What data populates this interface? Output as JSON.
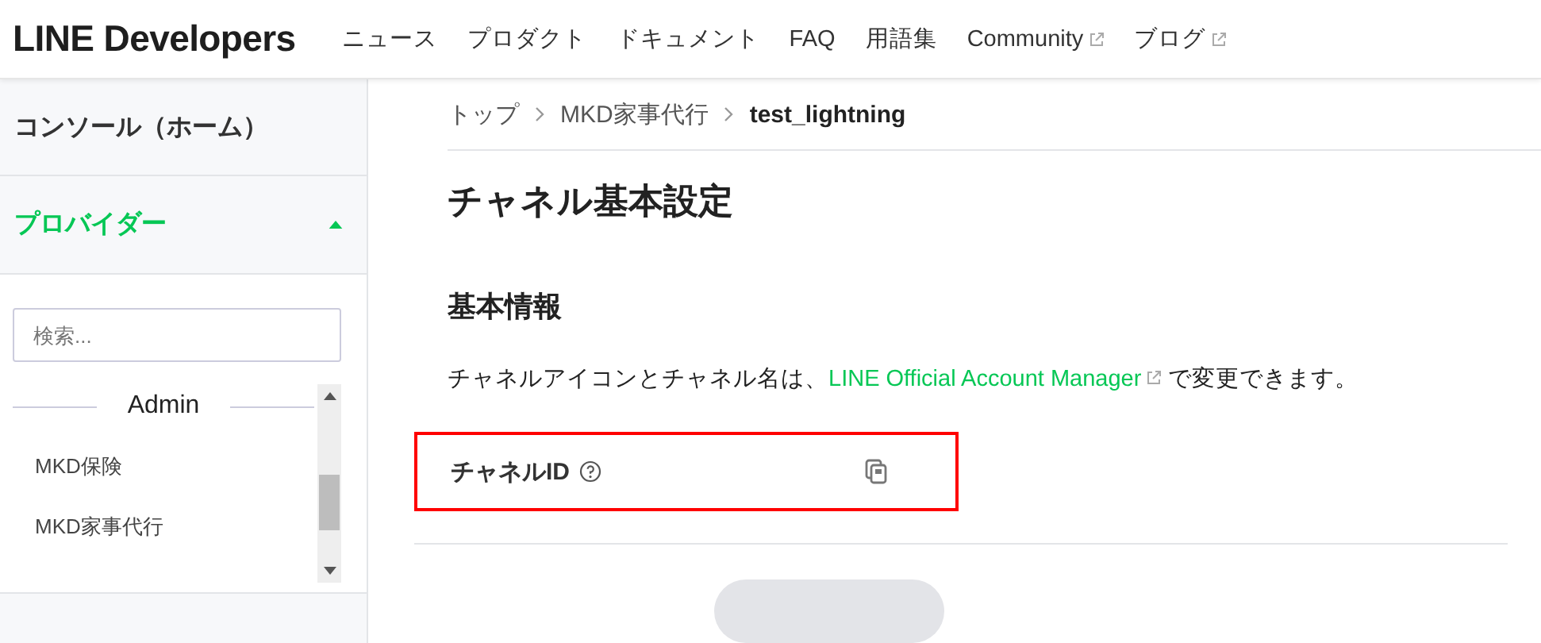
{
  "header": {
    "logo": "LINE Developers",
    "nav": [
      {
        "label": "ニュース",
        "external": false
      },
      {
        "label": "プロダクト",
        "external": false
      },
      {
        "label": "ドキュメント",
        "external": false
      },
      {
        "label": "FAQ",
        "external": false
      },
      {
        "label": "用語集",
        "external": false
      },
      {
        "label": "Community",
        "external": true
      },
      {
        "label": "ブログ",
        "external": true
      }
    ]
  },
  "sidebar": {
    "console": "コンソール（ホーム）",
    "provider": {
      "label": "プロバイダー",
      "expanded": true
    },
    "search": {
      "placeholder": "検索..."
    },
    "items": [
      {
        "label": "MKD保険"
      },
      {
        "label": "MKD家事代行"
      }
    ],
    "overlay_label": "Admin"
  },
  "breadcrumb": [
    "トップ",
    "MKD家事代行",
    "test_lightning"
  ],
  "title": "チャネル基本設定",
  "section": {
    "heading": "基本情報",
    "text_before": "チャネルアイコンとチャネル名は、",
    "link": "LINE Official Account Manager",
    "text_after": "で変更できます。",
    "fields": [
      {
        "label": "チャネルID",
        "highlighted": true
      }
    ]
  }
}
